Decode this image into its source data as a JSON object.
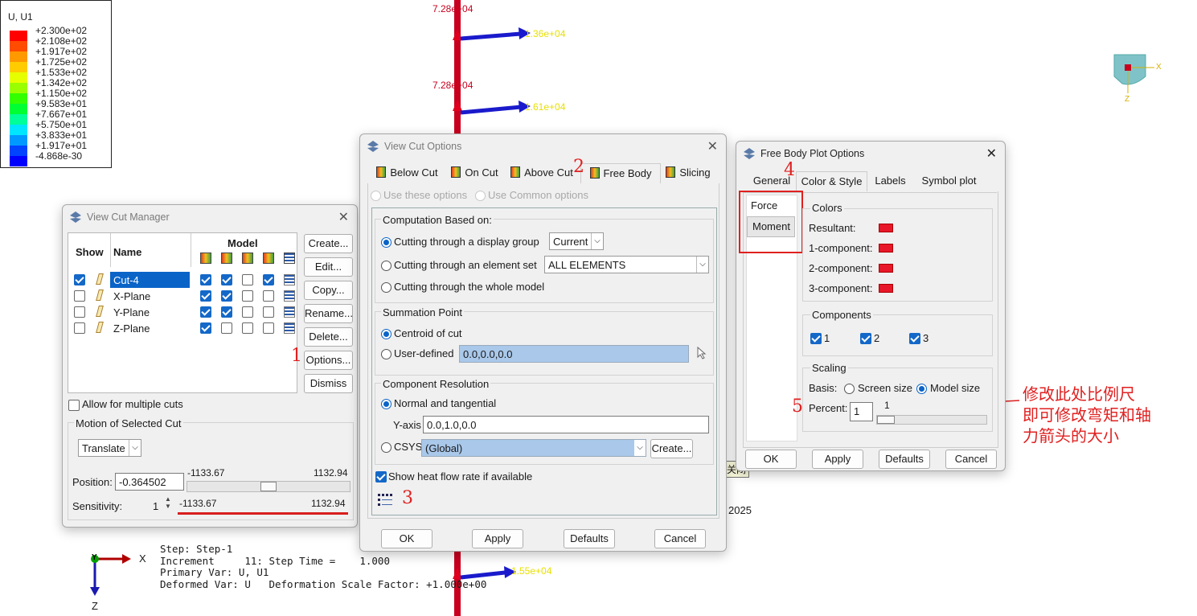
{
  "legend": {
    "title": "U, U1",
    "values": [
      "+2.300e+02",
      "+2.108e+02",
      "+1.917e+02",
      "+1.725e+02",
      "+1.533e+02",
      "+1.342e+02",
      "+1.150e+02",
      "+9.583e+01",
      "+7.667e+01",
      "+5.750e+01",
      "+3.833e+01",
      "+1.917e+01",
      "-4.868e-30"
    ],
    "colors": [
      "#ff0000",
      "#ff4c00",
      "#ff9900",
      "#ffcc00",
      "#e6ff00",
      "#99ff00",
      "#33ff00",
      "#00ff33",
      "#00ff99",
      "#00e6ff",
      "#0099ff",
      "#0044ff",
      "#0000ff"
    ]
  },
  "viewport": {
    "labels": {
      "l1": "7.28e+04",
      "l2": "7.28e+04",
      "y1": "1.36e+04",
      "y2": "1.61e+04",
      "y3": "1.55e+04"
    },
    "year": "2025",
    "info": {
      "step": "Step: Step-1",
      "increment": "Increment     11: Step Time =    1.000",
      "primary": "Primary Var: U, U1",
      "deformed": "Deformed Var: U   Deformation Scale Factor: +1.000e+00"
    },
    "triad": {
      "x": "X",
      "y": "Y",
      "z": "Z"
    },
    "minitriad": {
      "x": "X",
      "z": "Z"
    }
  },
  "tooltip": "关闭",
  "annotation_note": "修改此处比例尺\n即可修改弯矩和轴\n力箭头的大小",
  "markers": [
    "1",
    "2",
    "3",
    "4",
    "5"
  ],
  "manager": {
    "title": "View Cut Manager",
    "col_show": "Show",
    "col_name": "Name",
    "col_model": "Model",
    "rows": [
      {
        "name": "Cut-4",
        "show": true,
        "m": [
          true,
          true,
          false,
          true
        ]
      },
      {
        "name": "X-Plane",
        "show": false,
        "m": [
          true,
          true,
          false,
          false
        ]
      },
      {
        "name": "Y-Plane",
        "show": false,
        "m": [
          true,
          true,
          false,
          false
        ]
      },
      {
        "name": "Z-Plane",
        "show": false,
        "m": [
          true,
          false,
          false,
          false
        ]
      }
    ],
    "buttons": [
      "Create...",
      "Edit...",
      "Copy...",
      "Rename...",
      "Delete...",
      "Options...",
      "Dismiss"
    ],
    "allow_multiple": "Allow for multiple cuts",
    "motion_group": "Motion of Selected Cut",
    "motion_mode": "Translate",
    "position_label": "Position:",
    "position_value": "-0.364502",
    "range_min": "-1133.67",
    "range_max": "1132.94",
    "sensitivity_label": "Sensitivity:",
    "sensitivity_value": "1",
    "position_fraction": 0.5
  },
  "options": {
    "title": "View Cut Options",
    "tabs": [
      "Below Cut",
      "On Cut",
      "Above Cut",
      "Free Body",
      "Slicing"
    ],
    "active_tab": "Free Body",
    "use_these": "Use these options",
    "use_common": "Use Common options",
    "computation_group": "Computation Based on:",
    "comp_display_group": "Cutting through a display group",
    "comp_display_value": "Current",
    "comp_element_set": "Cutting through an element set",
    "comp_element_value": "ALL ELEMENTS",
    "comp_whole": "Cutting through the whole model",
    "summation_group": "Summation Point",
    "sum_centroid": "Centroid of cut",
    "sum_user": "User-defined",
    "sum_user_value": "0.0,0.0,0.0",
    "resolution_group": "Component Resolution",
    "res_normal": "Normal and tangential",
    "yaxis_label": "Y-axis",
    "yaxis_value": "0.0,1.0,0.0",
    "csys_label": "CSYS",
    "csys_value": "(Global)",
    "create_btn": "Create...",
    "heat_flow": "Show heat flow rate if available",
    "ok": "OK",
    "apply": "Apply",
    "defaults": "Defaults",
    "cancel": "Cancel"
  },
  "fbp": {
    "title": "Free Body Plot Options",
    "tabs": [
      "General",
      "Color & Style",
      "Labels",
      "Symbol plot"
    ],
    "active_tab": "Color & Style",
    "list": [
      "Force",
      "Moment"
    ],
    "colors_group": "Colors",
    "resultant": "Resultant:",
    "comp1": "1-component:",
    "comp2": "2-component:",
    "comp3": "3-component:",
    "components_group": "Components",
    "c1": "1",
    "c2": "2",
    "c3": "3",
    "scaling_group": "Scaling",
    "basis_label": "Basis:",
    "screen_size": "Screen size",
    "model_size": "Model size",
    "percent_label": "Percent:",
    "percent_value": "1",
    "slider_label": "1",
    "ok": "OK",
    "apply": "Apply",
    "defaults": "Defaults",
    "cancel": "Cancel"
  }
}
